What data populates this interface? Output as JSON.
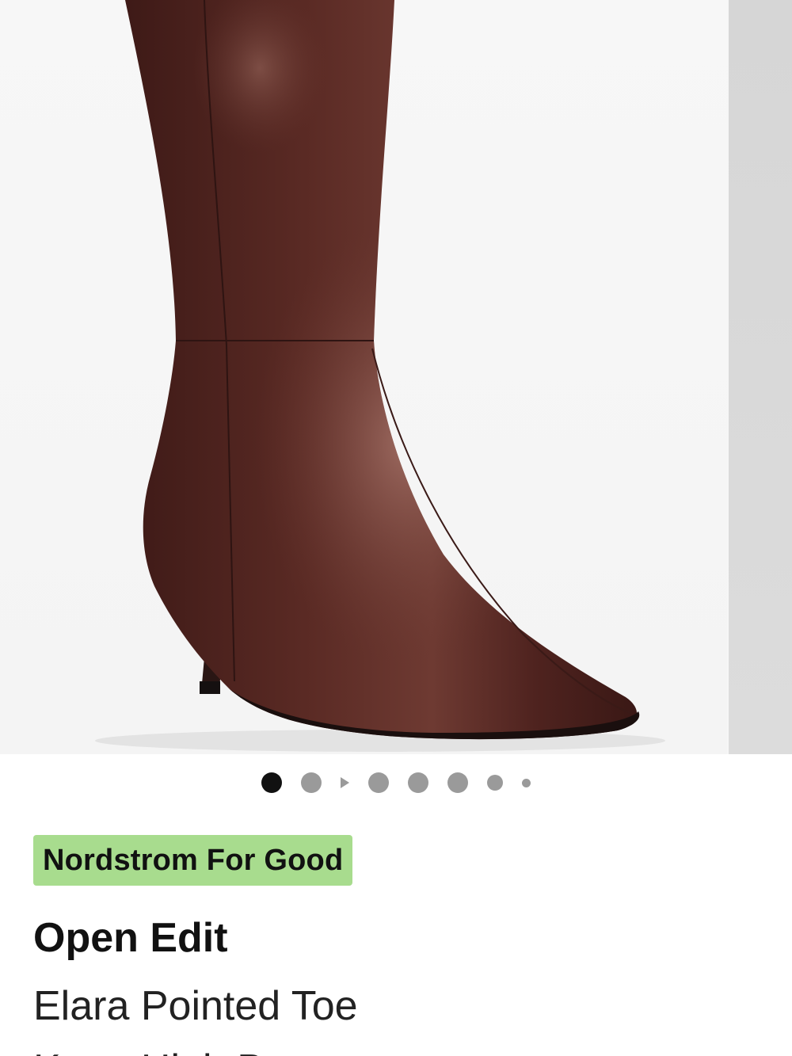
{
  "carousel": {
    "image_alt": "Brown leather knee-high boot with pointed toe and kitten heel",
    "boot_color": "#5a2a24",
    "pagination": {
      "active_index": 0,
      "items": [
        "photo",
        "photo",
        "video",
        "photo",
        "photo",
        "photo",
        "photo",
        "photo"
      ]
    }
  },
  "product": {
    "badge": "Nordstrom For Good",
    "badge_color": "#a8dc8e",
    "brand": "Open Edit",
    "name_line1": "Elara Pointed Toe",
    "name_line2": "Knee High Boot"
  }
}
